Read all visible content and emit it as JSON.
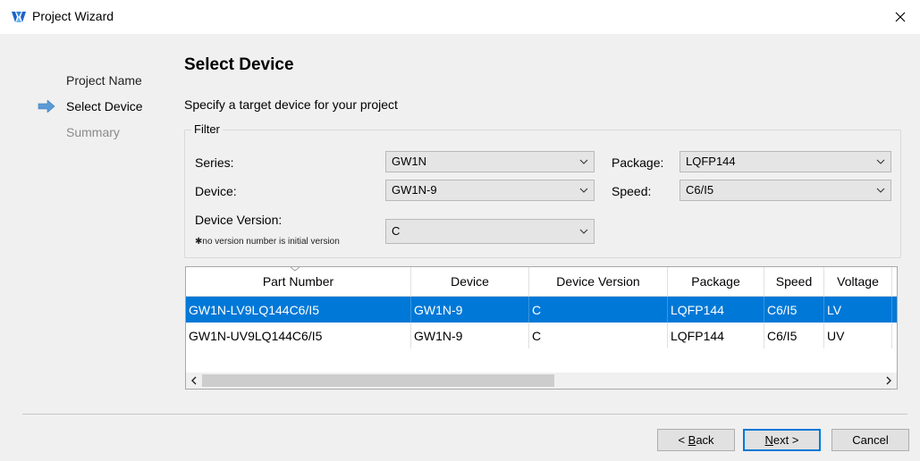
{
  "window": {
    "title": "Project Wizard"
  },
  "steps": [
    {
      "label": "Project Name",
      "state": "done"
    },
    {
      "label": "Select Device",
      "state": "active"
    },
    {
      "label": "Summary",
      "state": "pending"
    }
  ],
  "header": {
    "title": "Select Device",
    "subtitle": "Specify a target device for your project"
  },
  "filter": {
    "legend": "Filter",
    "series_label": "Series:",
    "series_value": "GW1N",
    "device_label": "Device:",
    "device_value": "GW1N-9",
    "version_label": "Device Version:",
    "version_note": "✱no version number is initial version",
    "version_value": "C",
    "package_label": "Package:",
    "package_value": "LQFP144",
    "speed_label": "Speed:",
    "speed_value": "C6/I5"
  },
  "table": {
    "columns": [
      "Part Number",
      "Device",
      "Device Version",
      "Package",
      "Speed",
      "Voltage"
    ],
    "rows": [
      {
        "cells": [
          "GW1N-LV9LQ144C6/I5",
          "GW1N-9",
          "C",
          "LQFP144",
          "C6/I5",
          "LV"
        ],
        "selected": true
      },
      {
        "cells": [
          "GW1N-UV9LQ144C6/I5",
          "GW1N-9",
          "C",
          "LQFP144",
          "C6/I5",
          "UV"
        ],
        "selected": false
      }
    ]
  },
  "buttons": {
    "back_mnemonic": "B",
    "back_rest": "ack",
    "back_prefix": "< ",
    "next_mnemonic": "N",
    "next_rest": "ext >",
    "cancel": "Cancel"
  },
  "icons": {
    "app": "gowin-logo-icon",
    "close": "close-icon",
    "step_arrow": "arrow-right-icon",
    "combo": "chevron-down-icon"
  },
  "colors": {
    "selection": "#0078d7",
    "step_arrow": "#5b9bd5",
    "logo": "#1e64c8"
  }
}
